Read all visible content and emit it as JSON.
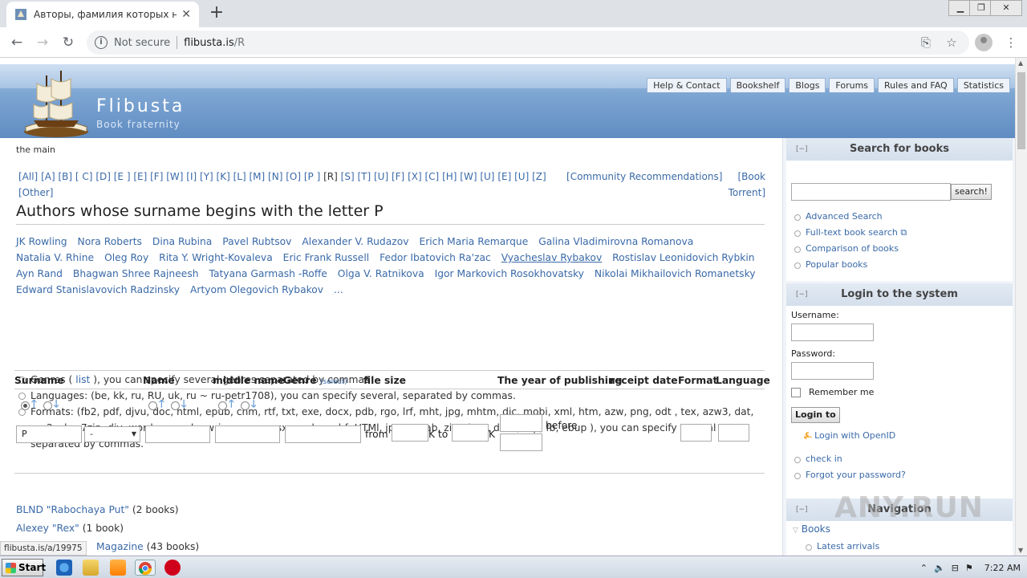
{
  "browser": {
    "tab_title": "Авторы, фамилия которых начин",
    "omnibox_security": "Not secure",
    "url_host": "flibusta.is",
    "url_path": "/R"
  },
  "site": {
    "name": "Flibusta",
    "tagline": "Book fraternity",
    "nav": [
      "Help & Contact",
      "Bookshelf",
      "Blogs",
      "Forums",
      "Rules and FAQ",
      "Statistics"
    ]
  },
  "main": {
    "breadcrumb": "the main",
    "alphabet": [
      "[All]",
      "[A]",
      "[B]",
      "[ C]",
      "[D]",
      "[E ]",
      "[E]",
      "[F]",
      "[W]",
      "[I]",
      "[Y]",
      "[K]",
      "[L]",
      "[M]",
      "[N]",
      "[O]",
      "[P ]",
      "[R]",
      "[S]",
      "[T]",
      "[U]",
      "[F]",
      "[X]",
      "[C]",
      "[H]",
      "[W]",
      "[U]",
      "[E]",
      "[U]",
      "[Z]",
      "[Other]"
    ],
    "alphabet_current_index": 17,
    "community_link": "[Community Recommendations]",
    "torrent_link": "[Book Torrent]",
    "title": "Authors whose surname begins with the letter P",
    "authors": [
      "JK Rowling",
      "Nora Roberts",
      "Dina Rubina",
      "Pavel Rubtsov",
      "Alexander V. Rudazov",
      "Erich Maria Remarque",
      "Galina Vladimirovna Romanova",
      "Natalia V. Rhine",
      "Oleg Roy",
      "Rita Y. Wright-Kovaleva",
      "Eric Frank Russell",
      "Fedor Ibatovich Ra'zac",
      "Vyacheslav Rybakov",
      "Rostislav Leonidovich Rybkin",
      "Ayn Rand",
      "Bhagwan Shree Rajneesh",
      "Tatyana Garmash -Roffe",
      "Olga V. Ratnikova",
      "Igor Markovich Rosokhovatsky",
      "Nikolai Mikhailovich Romanetsky",
      "Edward Stanislavovich Radzinsky",
      "Artyom Olegovich Rybakov",
      "..."
    ],
    "underlined_author_index": 12,
    "options": {
      "genres_pre": "Genres (",
      "genres_link": "list",
      "genres_post": "), you can specify several genres separated by commas",
      "languages": "Languages: (be, kk, ru, RU, uk, ru ~ ru-petr1708), you can specify several, separated by commas.",
      "formats": "Formats: (fb2, pdf, djvu, doc, html, epub, chm, rtf, txt, exe, docx, pdb, rgo, lrf, mht, jpg, mhtm, dic, mobi, xml, htm, azw, png, odt , tex, azw3, dat, mp3, cbr, 7zip, djv, word, prc, pdg, wri, wps, xps, sxw, gdoc, phf, HTMl, jpeg, epab, zip, docs, dock, bqt, fb, ebup ), you can specify several separated by commas."
    },
    "search_table": {
      "headers": {
        "surname": "Surname",
        "name": "Name",
        "middle": "middle name",
        "genre": "Genre",
        "genre_select": "(select)",
        "filesize": "file size",
        "year": "The year of publishing",
        "receipt": "receipt date",
        "format": "Format",
        "language": "Language"
      },
      "surname_value": "Р",
      "select_value": "-",
      "from_label": "from",
      "k_to_label": "K to",
      "k_label": "K",
      "before_label": "before"
    },
    "results": [
      {
        "name": "BLND \"Rabochaya Put\"",
        "count": "(2 books)"
      },
      {
        "name": "Alexey \"Rex\"",
        "count": "(1 book)"
      },
      {
        "name": "Magazine",
        "count": "(43 books)"
      }
    ]
  },
  "sidebar": {
    "search_title": "Search for books",
    "collapse": "[−]",
    "search_button": "search!",
    "search_links": [
      "Advanced Search",
      "Full-text book search",
      "Comparison of books",
      "Popular books"
    ],
    "login_title": "Login to the system",
    "username_label": "Username:",
    "password_label": "Password:",
    "remember_label": "Remember me",
    "login_button": "Login to",
    "openid_link": "Login with OpenID",
    "login_links": [
      "check in",
      "Forgot your password?"
    ],
    "nav_title": "Navigation",
    "nav_books": "Books",
    "nav_latest": "Latest arrivals"
  },
  "status_url": "flibusta.is/a/19975",
  "watermark": "ANY.RUN",
  "taskbar": {
    "start": "Start",
    "clock": "7:22 AM"
  }
}
